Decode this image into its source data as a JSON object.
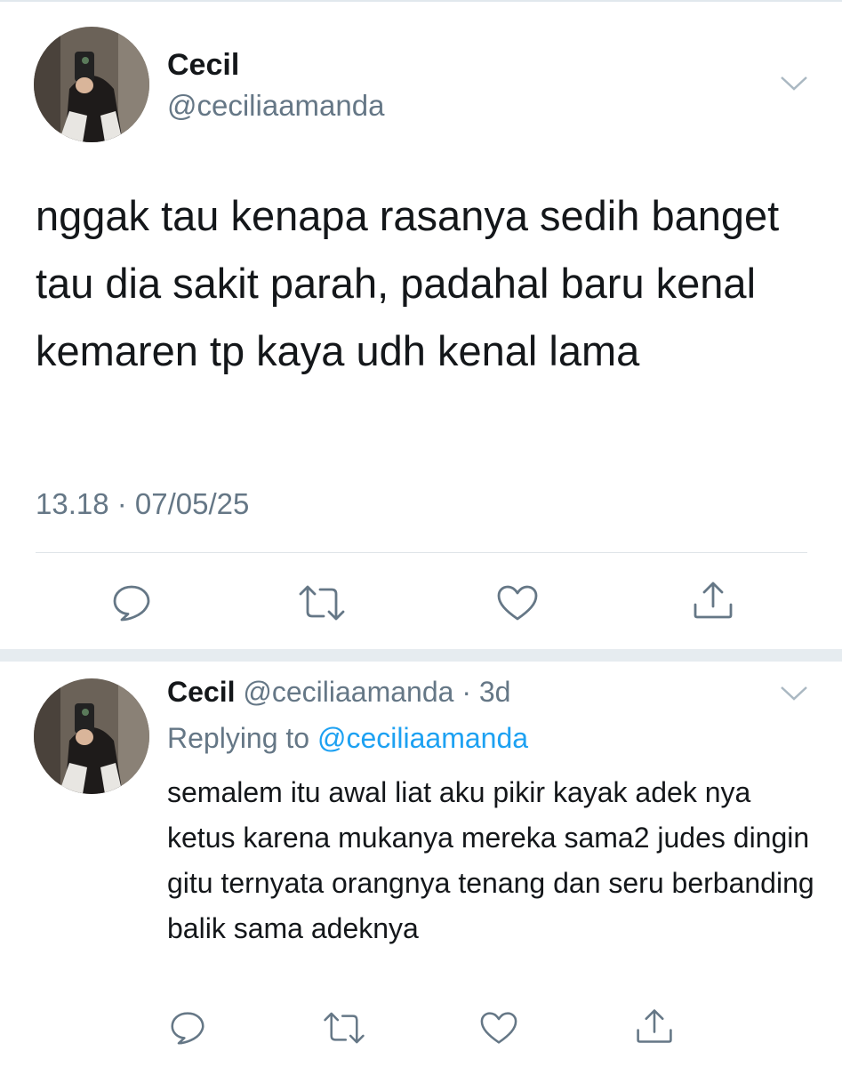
{
  "tweet": {
    "name": "Cecil",
    "handle": "@ceciliaamanda",
    "text": "nggak tau kenapa rasanya sedih banget tau dia sakit parah, padahal baru kenal kemaren tp kaya udh kenal lama",
    "timestamp": "13.18 · 07/05/25",
    "actions": [
      "reply-icon",
      "retweet-icon",
      "like-icon",
      "share-icon"
    ]
  },
  "reply": {
    "name": "Cecil",
    "handle": "@ceciliaamanda",
    "separator": " · ",
    "age": "3d",
    "replying_prefix": "Replying to ",
    "replying_to": "@ceciliaamanda",
    "text": "semalem itu awal liat aku pikir kayak adek nya ketus karena mukanya mereka sama2 judes dingin gitu ternyata orangnya tenang dan seru berbanding balik sama adeknya",
    "actions": [
      "reply-icon",
      "retweet-icon",
      "like-icon",
      "share-icon"
    ]
  },
  "colors": {
    "text_primary": "#14171a",
    "text_secondary": "#657786",
    "link": "#1da1f2",
    "icon": "#657786",
    "divider": "#e6ecf0"
  }
}
